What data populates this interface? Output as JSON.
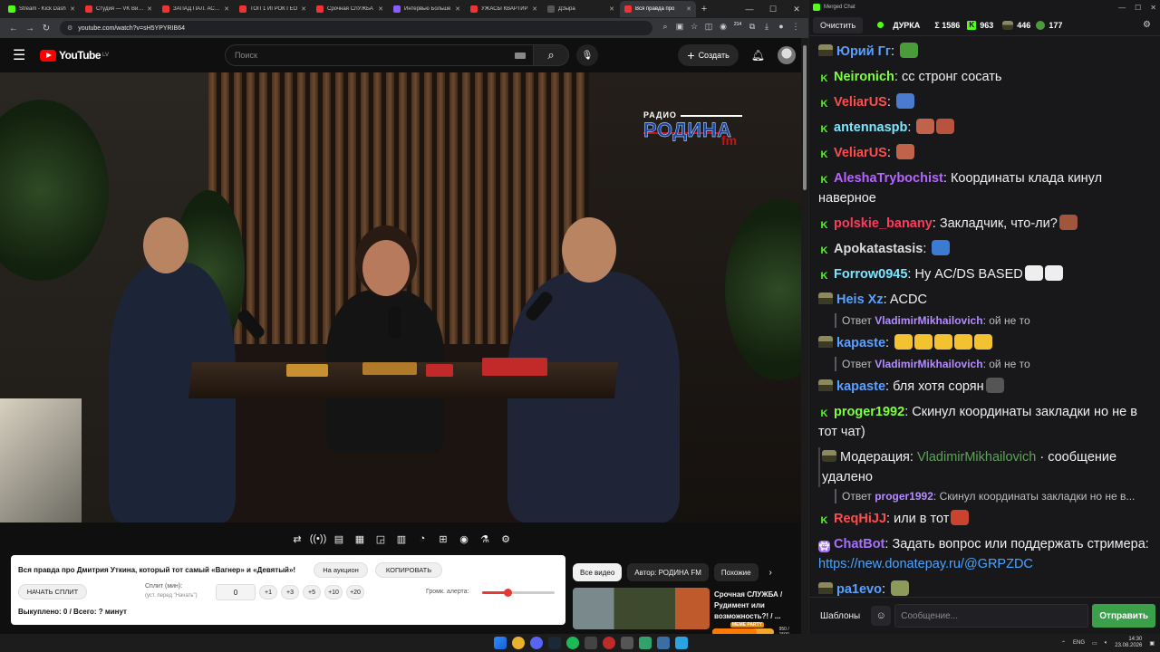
{
  "browser": {
    "tabs": [
      {
        "label": "Stream - Kick Dash",
        "color": "#53fc18",
        "active": false
      },
      {
        "label": "Студия — VK Видео",
        "color": "#e33",
        "active": false
      },
      {
        "label": "ЗАПАД ПАЛ. АСМР",
        "color": "#e33",
        "active": false
      },
      {
        "label": "ТОП 1 ИГРОК ГЕО",
        "color": "#e33",
        "active": false
      },
      {
        "label": "Срочная СЛУЖБА",
        "color": "#e33",
        "active": false
      },
      {
        "label": "Интервью Больше",
        "color": "#8a5cff",
        "active": false
      },
      {
        "label": "УЖАСЫ КВАРТИР",
        "color": "#e33",
        "active": false
      },
      {
        "label": "ДЗыра",
        "color": "#555",
        "active": false
      },
      {
        "label": "Вся правда про",
        "color": "#e33",
        "active": true
      }
    ],
    "new_tab": "+",
    "url": "youtube.com/watch?v=sH5YPYRIB64",
    "ext_badge": "214"
  },
  "youtube": {
    "logo": "YouTube",
    "region": "LV",
    "search_placeholder": "Поиск",
    "create_label": "Создать"
  },
  "video": {
    "logo_line1": "РАДИО",
    "logo_line2": "РОДИНА",
    "logo_line3": "fm"
  },
  "split_panel": {
    "title": "Вся правда про Дмитрия Уткина, который тот самый «Вагнер» и «Девятый»!",
    "auction_label": "На аукцион",
    "copy_label": "КОПИРОВАТЬ",
    "start_label": "НАЧАТЬ СПЛИТ",
    "minutes_label": "Сплит (мин):",
    "minutes_hint": "(уст. перед \"Начать\")",
    "minutes_value": "0",
    "steps": [
      "+1",
      "+3",
      "+5",
      "+10",
      "+20"
    ],
    "volume_label": "Громк. алерта:",
    "volume_level": 0.35,
    "bought": "Выкуплено: 0 / Всего: ? минут"
  },
  "recommend": {
    "chips": [
      {
        "label": "Все видео",
        "active": true
      },
      {
        "label": "Автор: РОДИНА FM",
        "active": false
      },
      {
        "label": "Похожие",
        "active": false
      }
    ],
    "video_title": "Срочная СЛУЖБА / Рудимент или возможность?! / ..."
  },
  "meme_party": {
    "label": "MEME PARTY",
    "count": "950 / 1500",
    "progress": 0.63
  },
  "chat": {
    "window_title": "Merged Chat",
    "clear_label": "Очистить",
    "channel": "ДУРКА",
    "total": "Σ 1586",
    "kick_count": "963",
    "count_2": "446",
    "count_3": "177",
    "messages": [
      {
        "type": "msg",
        "badge": "soldier",
        "user": "Юрий Гг",
        "color": "#5aa0ff",
        "text": "",
        "emotes": [
          "#4b9b3a"
        ]
      },
      {
        "type": "msg",
        "badge": "kick",
        "user": "Neironich",
        "color": "#7dff3b",
        "text": "сс стронг сосать",
        "emotes": []
      },
      {
        "type": "msg",
        "badge": "kick",
        "user": "VeliarUS",
        "color": "#ff4d4d",
        "text": "",
        "emotes": [
          "#4a7bd0"
        ]
      },
      {
        "type": "msg",
        "badge": "kick",
        "user": "antennaspb",
        "color": "#7be7ff",
        "text": "",
        "emotes": [
          "#c0634a",
          "#b8543e"
        ]
      },
      {
        "type": "msg",
        "badge": "kick",
        "user": "VeliarUS",
        "color": "#ff4d4d",
        "text": "",
        "emotes": [
          "#c0634a"
        ]
      },
      {
        "type": "msg",
        "badge": "kick",
        "user": "AleshaTrybochist",
        "color": "#b466ff",
        "text": "Координаты клада кинул наверное",
        "emotes": []
      },
      {
        "type": "msg",
        "badge": "kick",
        "user": "polskie_banany",
        "color": "#ff3b5c",
        "text": "Закладчик, что-ли?",
        "emotes": [
          "#a0553c"
        ]
      },
      {
        "type": "msg",
        "badge": "kick",
        "user": "Apokatastasis",
        "color": "#dcdcdc",
        "text": "",
        "emotes": [
          "#3c7bd4"
        ]
      },
      {
        "type": "msg",
        "badge": "kick",
        "user": "Forrow0945",
        "color": "#7be7ff",
        "text": "Ну AC/DS BASED",
        "emotes": [
          "#eeeeee",
          "#eeeeee"
        ]
      },
      {
        "type": "msg",
        "badge": "soldier",
        "user": "Heis Xz",
        "color": "#5aa0ff",
        "text": "ACDC",
        "emotes": []
      },
      {
        "type": "reply",
        "ruser": "VladimirMikhailovich",
        "text": "ой не то"
      },
      {
        "type": "msg",
        "badge": "soldier",
        "user": "kapaste",
        "color": "#5aa0ff",
        "text": "",
        "emotes": [
          "#f2c230",
          "#f2c230",
          "#f2c230",
          "#f2c230",
          "#f2c230"
        ]
      },
      {
        "type": "reply",
        "ruser": "VladimirMikhailovich",
        "text": "ой не то"
      },
      {
        "type": "msg",
        "badge": "soldier",
        "user": "kapaste",
        "color": "#5aa0ff",
        "text": "бля хотя сорян",
        "emotes": [
          "#555555"
        ]
      },
      {
        "type": "msg",
        "badge": "kick",
        "user": "proger1992",
        "color": "#7dff3b",
        "text": "Скинул координаты закладки но не в тот чат)",
        "emotes": []
      },
      {
        "type": "mod",
        "prefix": "Модерация:",
        "modname": "VladimirMikhailovich",
        "text": "· сообщение удалено"
      },
      {
        "type": "reply",
        "ruser": "proger1992",
        "text": "Скинул координаты закладки но не в..."
      },
      {
        "type": "msg",
        "badge": "kick",
        "user": "ReqHiJJ",
        "color": "#ff4d4d",
        "text": "или в тот",
        "emotes": [
          "#c9432e"
        ]
      },
      {
        "type": "msg",
        "badge": "bot",
        "user": "ChatBot",
        "color": "#a970ff",
        "text": "Задать вопрос или поддержать стримера:",
        "link": "https://new.donatepay.ru/@GRPZDC",
        "emotes": []
      },
      {
        "type": "msg",
        "badge": "soldier",
        "user": "pa1evo",
        "color": "#5aa0ff",
        "text": "",
        "emotes": [
          "#8c9a5a"
        ]
      }
    ],
    "reply_prefix": "Ответ",
    "templates_label": "Шаблоны",
    "input_placeholder": "Сообщение...",
    "send_label": "Отправить"
  },
  "taskbar": {
    "lang": "ENG",
    "time": "14:30",
    "date": "23.08.2026"
  }
}
